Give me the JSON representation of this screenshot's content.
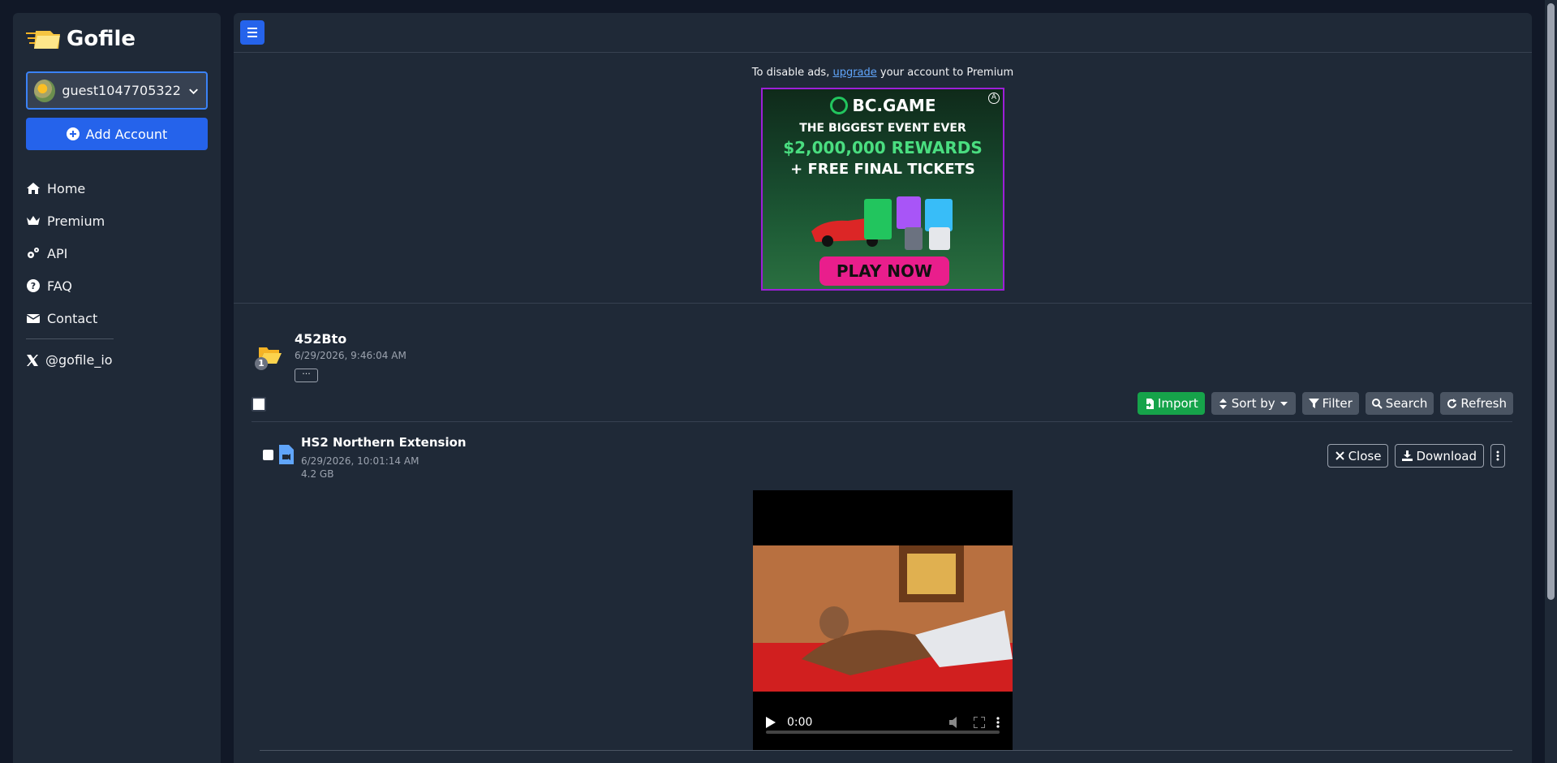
{
  "brand": {
    "name": "Gofile"
  },
  "account": {
    "name": "guest1047705322",
    "add_label": "Add Account"
  },
  "nav": {
    "items": [
      {
        "label": "Home",
        "icon": "home-icon"
      },
      {
        "label": "Premium",
        "icon": "crown-icon"
      },
      {
        "label": "API",
        "icon": "cogs-icon"
      },
      {
        "label": "FAQ",
        "icon": "question-circle-icon"
      },
      {
        "label": "Contact",
        "icon": "envelope-icon"
      }
    ],
    "social": {
      "label": "@gofile_io",
      "icon": "x-twitter-icon"
    }
  },
  "ad": {
    "note_prefix": "To disable ads, ",
    "note_link": "upgrade",
    "note_suffix": " your account to Premium",
    "brand": "BC.GAME",
    "line1": "THE BIGGEST EVENT EVER",
    "line2": "$2,000,000 REWARDS",
    "line3": "+ FREE FINAL TICKETS",
    "cta": "PLAY NOW"
  },
  "folder": {
    "name": "452Bto",
    "date": "6/29/2026, 9:46:04 AM",
    "count": "1",
    "more_label": "···"
  },
  "toolbar": {
    "import_label": "Import",
    "sort_label": "Sort by",
    "filter_label": "Filter",
    "search_label": "Search",
    "refresh_label": "Refresh"
  },
  "file": {
    "name": "HS2 Northern Extension",
    "date": "6/29/2026, 10:01:14 AM",
    "size": "4.2 GB",
    "close_label": "Close",
    "download_label": "Download"
  },
  "video": {
    "time": "0:00"
  },
  "colors": {
    "accent": "#2563eb",
    "success": "#16a34a",
    "background": "#111827",
    "panel": "#1f2937"
  }
}
